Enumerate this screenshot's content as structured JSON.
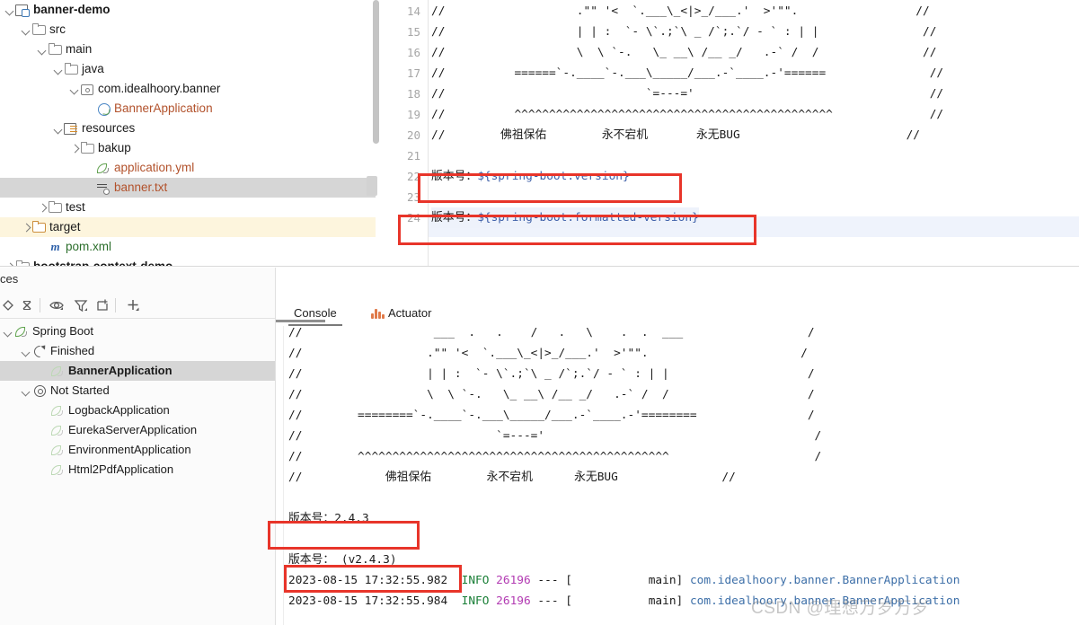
{
  "project_tree": {
    "name": "project-tree",
    "rows": [
      {
        "label": "banner-demo",
        "indent": 0,
        "arrow": "down",
        "icon": "module-icon",
        "style": "bold",
        "state": "normal"
      },
      {
        "label": "src",
        "indent": 1,
        "arrow": "down",
        "icon": "folder-icon",
        "style": "normal",
        "state": "normal"
      },
      {
        "label": "main",
        "indent": 2,
        "arrow": "down",
        "icon": "folder-icon",
        "style": "normal",
        "state": "normal"
      },
      {
        "label": "java",
        "indent": 3,
        "arrow": "down",
        "icon": "folder-icon",
        "style": "normal",
        "state": "normal"
      },
      {
        "label": "com.idealhoory.banner",
        "indent": 4,
        "arrow": "down",
        "icon": "package-icon",
        "style": "normal",
        "state": "normal"
      },
      {
        "label": "BannerApplication",
        "indent": 5,
        "arrow": "none",
        "icon": "spring-class-icon",
        "style": "orange",
        "state": "normal"
      },
      {
        "label": "resources",
        "indent": 3,
        "arrow": "down",
        "icon": "resources-folder-icon",
        "style": "normal",
        "state": "normal"
      },
      {
        "label": "bakup",
        "indent": 4,
        "arrow": "right",
        "icon": "folder-icon",
        "style": "normal",
        "state": "normal"
      },
      {
        "label": "application.yml",
        "indent": 5,
        "arrow": "none",
        "icon": "spring-yaml-icon",
        "style": "orange",
        "state": "normal"
      },
      {
        "label": "banner.txt",
        "indent": 5,
        "arrow": "none",
        "icon": "text-file-icon",
        "style": "orange",
        "state": "selected"
      },
      {
        "label": "test",
        "indent": 2,
        "arrow": "right",
        "icon": "folder-icon",
        "style": "normal",
        "state": "normal"
      },
      {
        "label": "target",
        "indent": 1,
        "arrow": "right",
        "icon": "folder-orange-icon",
        "style": "normal",
        "state": "excluded"
      },
      {
        "label": "pom.xml",
        "indent": 2,
        "arrow": "none",
        "icon": "maven-icon",
        "style": "green",
        "state": "normal"
      },
      {
        "label": "bootstrap-context-demo",
        "indent": 0,
        "arrow": "right",
        "icon": "folder-icon",
        "style": "bold",
        "state": "clipped"
      }
    ]
  },
  "editor": {
    "name": "banner-txt-editor",
    "first_line_number": 14,
    "lines": [
      {
        "n": 14,
        "text": "//                   .\"\" '<  `.___\\_<|>_/___.'  >'\"\".                 //"
      },
      {
        "n": 15,
        "text": "//                   | | :  `- \\`.;`\\ _ /`;.`/ - ` : | |               //"
      },
      {
        "n": 16,
        "text": "//                   \\  \\ `-.   \\_ __\\ /__ _/   .-` /  /               //"
      },
      {
        "n": 17,
        "text": "//          ======`-.____`-.___\\_____/___.-`____.-'======               //"
      },
      {
        "n": 18,
        "text": "//                             `=---='                                  //"
      },
      {
        "n": 19,
        "text": "//          ^^^^^^^^^^^^^^^^^^^^^^^^^^^^^^^^^^^^^^^^^^^^^^              //"
      },
      {
        "n": 20,
        "text": "//        佛祖保佑        永不宕机       永无BUG                        //"
      },
      {
        "n": 21,
        "text": ""
      },
      {
        "n": 22,
        "text": "版本号：${spring-boot.version}",
        "highlighted": true,
        "prefix": "版本号：",
        "expr": "${spring-boot.version}"
      },
      {
        "n": 23,
        "text": ""
      },
      {
        "n": 24,
        "text": "版本号：${spring-boot.formatted-version}",
        "highlighted": true,
        "current": true,
        "prefix": "版本号：",
        "expr": "${spring-boot.formatted-version}"
      }
    ]
  },
  "services_panel": {
    "title": "ces",
    "toolbar_icons": [
      "rerun-icon",
      "stop-icon",
      "eye-icon",
      "filter-icon",
      "export-icon",
      "add-icon"
    ],
    "tree": [
      {
        "label": "Spring Boot",
        "indent": 0,
        "arrow": "down",
        "icon": "spring-leaf-icon",
        "state": "normal"
      },
      {
        "label": "Finished",
        "indent": 1,
        "arrow": "down",
        "icon": "refresh-icon",
        "state": "normal"
      },
      {
        "label": "BannerApplication",
        "indent": 2,
        "arrow": "none",
        "icon": "spring-leaf-dim-icon",
        "state": "selected"
      },
      {
        "label": "Not Started",
        "indent": 1,
        "arrow": "down",
        "icon": "gear-icon",
        "state": "normal"
      },
      {
        "label": "LogbackApplication",
        "indent": 2,
        "arrow": "none",
        "icon": "spring-leaf-dim-icon",
        "state": "normal"
      },
      {
        "label": "EurekaServerApplication",
        "indent": 2,
        "arrow": "none",
        "icon": "spring-leaf-dim-icon",
        "state": "normal"
      },
      {
        "label": "EnvironmentApplication",
        "indent": 2,
        "arrow": "none",
        "icon": "spring-leaf-dim-icon",
        "state": "normal"
      },
      {
        "label": "Html2PdfApplication",
        "indent": 2,
        "arrow": "none",
        "icon": "spring-leaf-dim-icon",
        "state": "normal"
      }
    ]
  },
  "console": {
    "tabs": [
      {
        "label": "Console",
        "active": true,
        "icon": "none"
      },
      {
        "label": "Actuator",
        "active": false,
        "icon": "actuator-icon"
      }
    ],
    "lines": [
      {
        "text": "//                   ___  .   .    /   .   \\    .  .  ___                  /"
      },
      {
        "text": "//                  .\"\" '<  `.___\\_<|>_/___.'  >'\"\".                      /"
      },
      {
        "text": "//                  | | :  `- \\`.;`\\ _ /`;.`/ - ` : | |                    /"
      },
      {
        "text": "//                  \\  \\ `-.   \\_ __\\ /__ _/   .-` /  /                    /"
      },
      {
        "text": "//        ========`-.____`-.___\\_____/___.-`____.-'========                /"
      },
      {
        "text": "//                            `=---='                                       /"
      },
      {
        "text": "//        ^^^^^^^^^^^^^^^^^^^^^^^^^^^^^^^^^^^^^^^^^^^^^                     /"
      },
      {
        "text": "//            佛祖保佑        永不宕机      永无BUG               //"
      },
      {
        "text": ""
      },
      {
        "text": "版本号：2.4.3",
        "highlighted": true
      },
      {
        "text": ""
      },
      {
        "text": "版本号： (v2.4.3)",
        "highlighted": true
      }
    ],
    "log_rows": [
      {
        "timestamp": "2023-08-15 17:32:55.982",
        "level": "INFO",
        "pid": "26196",
        "sep": "--- [",
        "thread": "main]",
        "logger": "com.idealhoory.banner.BannerApplication"
      },
      {
        "timestamp": "2023-08-15 17:32:55.984",
        "level": "INFO",
        "pid": "26196",
        "sep": "--- [",
        "thread": "main]",
        "logger": "com.idealhoory.banner.BannerApplication"
      }
    ]
  },
  "watermark": {
    "text": "CSDN @理想万岁万岁"
  },
  "colors": {
    "accent_red": "#e8352a",
    "orange_file": "#b2522c",
    "blue_expr": "#3d5fa8",
    "info_green": "#1a7f37",
    "pid_magenta": "#b23ab2",
    "selection_gray": "#d6d6d6",
    "excluded_yellow": "#fdf5dd"
  }
}
